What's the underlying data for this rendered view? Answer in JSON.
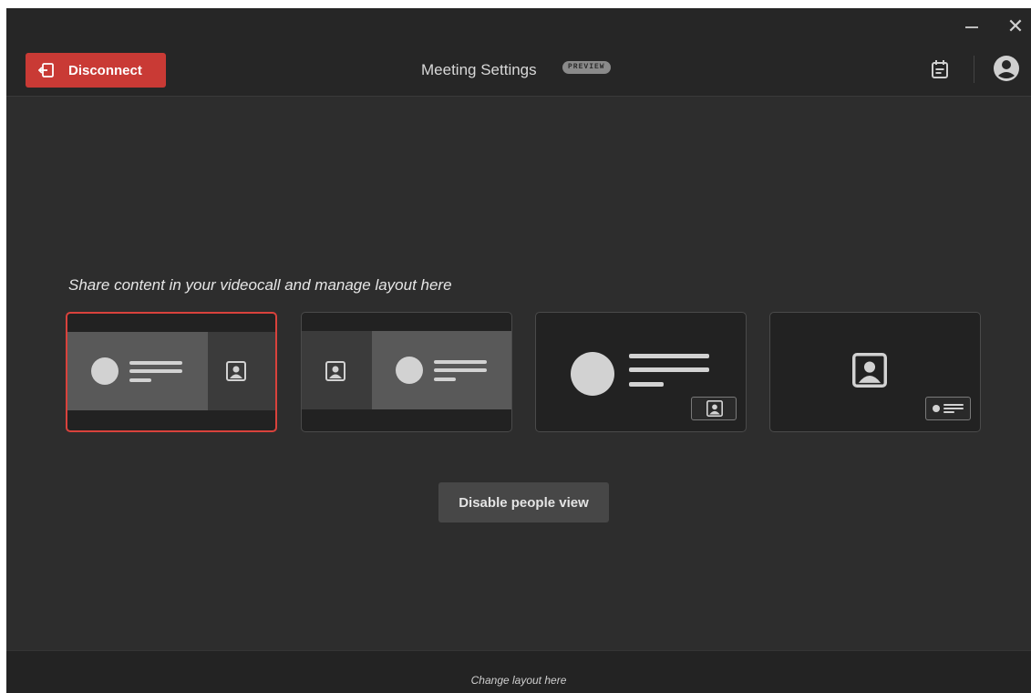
{
  "window": {
    "minimize_icon": "minimize-icon",
    "close_icon": "close-icon",
    "close_glyph": "✕"
  },
  "header": {
    "disconnect_label": "Disconnect",
    "disconnect_icon": "logout-icon",
    "title": "Meeting Settings",
    "badge": "PREVIEW",
    "calendar_icon": "calendar-icon",
    "account_icon": "account-icon"
  },
  "main": {
    "prompt": "Share content in your videocall and manage layout here",
    "layouts": [
      {
        "id": "content-left-people-right",
        "selected": true
      },
      {
        "id": "people-left-content-right",
        "selected": false
      },
      {
        "id": "content-full-people-pip",
        "selected": false
      },
      {
        "id": "people-full-content-pip",
        "selected": false
      }
    ],
    "disable_people_label": "Disable people view"
  },
  "footer": {
    "text": "Change layout here"
  },
  "colors": {
    "accent": "#c93a35",
    "background": "#2d2d2d",
    "selected_border": "#d9423c"
  }
}
